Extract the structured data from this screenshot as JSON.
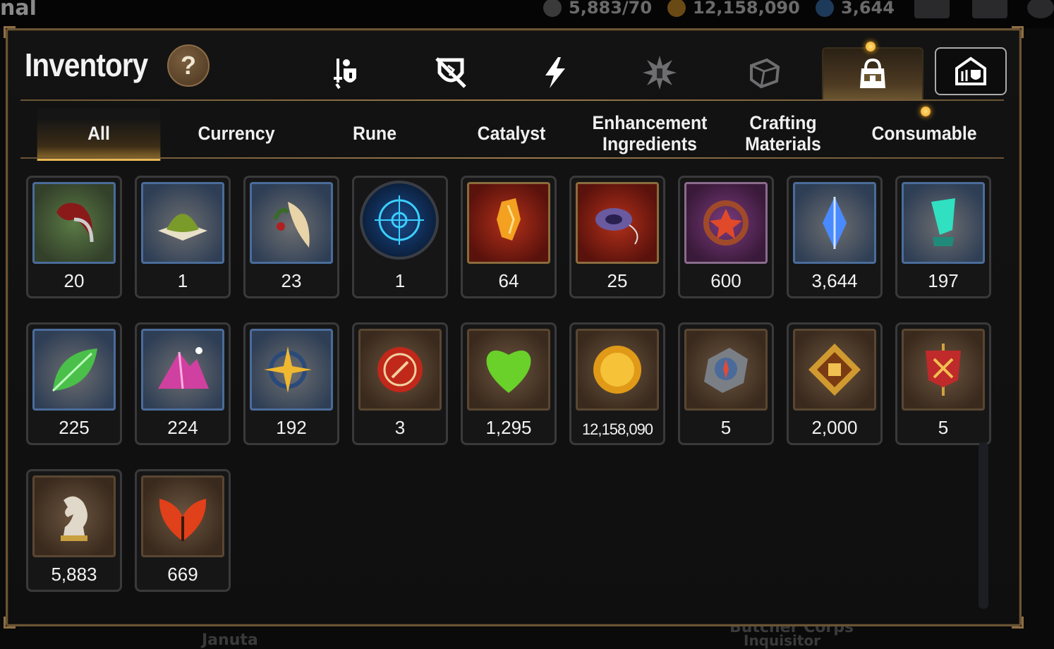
{
  "hud": {
    "left_text": "nal",
    "energy": "5,883/70",
    "silver": "12,158,090",
    "gems": "3,644",
    "bottom_left": "Januta",
    "bottom_right": "Butcher Corps",
    "bottom_right2": "Inquisitor"
  },
  "header": {
    "title": "Inventory",
    "help_label": "?"
  },
  "categories": [
    {
      "name": "gear",
      "icon": "sword-shield-icon"
    },
    {
      "name": "slashed-shield",
      "icon": "slashed-shield-icon"
    },
    {
      "name": "lightning",
      "icon": "lightning-icon"
    },
    {
      "name": "burst",
      "icon": "burst-icon"
    },
    {
      "name": "box",
      "icon": "box-icon"
    },
    {
      "name": "bag",
      "icon": "bag-icon"
    },
    {
      "name": "chest",
      "icon": "chest-icon"
    }
  ],
  "subtabs": [
    "All",
    "Currency",
    "Rune",
    "Catalyst",
    "Enhancement Ingredients",
    "Crafting Materials",
    "Consumable"
  ],
  "items": [
    {
      "name": "claw",
      "count": "20"
    },
    {
      "name": "moss-pile",
      "count": "1"
    },
    {
      "name": "feather-berry",
      "count": "23"
    },
    {
      "name": "blue-rune",
      "count": "1"
    },
    {
      "name": "amber-crystal",
      "count": "64"
    },
    {
      "name": "purple-scroll",
      "count": "25"
    },
    {
      "name": "flower-ring",
      "count": "600"
    },
    {
      "name": "blue-crystal",
      "count": "3,644"
    },
    {
      "name": "teal-crystal",
      "count": "197"
    },
    {
      "name": "green-leaf",
      "count": "225"
    },
    {
      "name": "pink-crystal",
      "count": "224"
    },
    {
      "name": "star-compass",
      "count": "192"
    },
    {
      "name": "red-seal",
      "count": "3"
    },
    {
      "name": "green-heart",
      "count": "1,295"
    },
    {
      "name": "gold-coin",
      "count": "12,158,090"
    },
    {
      "name": "stone-compass",
      "count": "5"
    },
    {
      "name": "fist-badge",
      "count": "2,000"
    },
    {
      "name": "war-banner",
      "count": "5"
    },
    {
      "name": "horse-piece",
      "count": "5,883"
    },
    {
      "name": "fire-leaf",
      "count": "669"
    }
  ],
  "colors": {
    "accent": "#e8b850",
    "frame": "#6b5433",
    "slot_border": "#3a3a3c"
  }
}
